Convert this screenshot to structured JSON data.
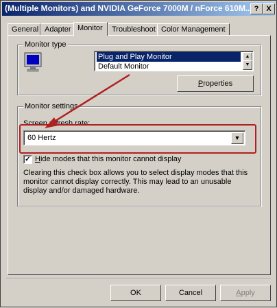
{
  "window": {
    "title": "(Multiple Monitors) and NVIDIA GeForce 7000M / nForce 610M...",
    "help_label": "?",
    "close_label": "X"
  },
  "tabs": [
    {
      "label": "General",
      "active": false
    },
    {
      "label": "Adapter",
      "active": false
    },
    {
      "label": "Monitor",
      "active": true
    },
    {
      "label": "Troubleshoot",
      "active": false
    },
    {
      "label": "Color Management",
      "active": false
    }
  ],
  "monitor_type": {
    "legend": "Monitor type",
    "icon": "monitor-icon",
    "items": [
      "Plug and Play Monitor",
      "Default Monitor"
    ],
    "selected": "Plug and Play Monitor",
    "properties_label": "Properties",
    "properties_mnemonic": "P",
    "properties_rest": "roperties"
  },
  "monitor_settings": {
    "legend": "Monitor settings",
    "refresh_label": "Screen refresh rate:",
    "refresh_value": "60 Hertz",
    "hide_modes": {
      "checked": true,
      "mnemonic": "H",
      "rest": "ide modes that this monitor cannot display"
    },
    "description": "Clearing this check box allows you to select display modes that this monitor cannot display correctly. This may lead to an unusable display and/or damaged hardware."
  },
  "footer": {
    "ok_label": "OK",
    "cancel_label": "Cancel",
    "apply_label": "Apply",
    "apply_mnemonic": "A",
    "apply_rest": "pply"
  },
  "annotation": {
    "color": "#b02020"
  }
}
